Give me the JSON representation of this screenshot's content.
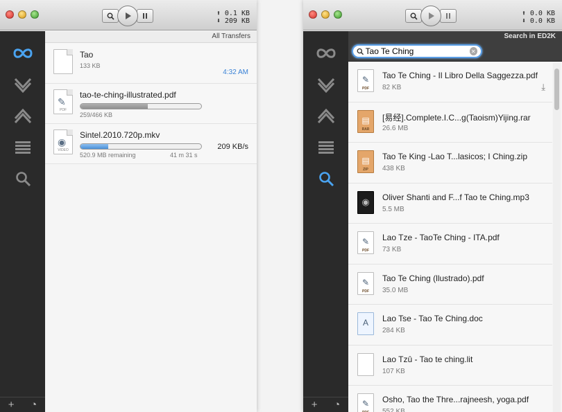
{
  "left_window": {
    "speeds": {
      "up": "0.1 KB",
      "down": "209 KB"
    },
    "header": "All Transfers",
    "transfers": [
      {
        "name": "Tao",
        "size": "133 KB",
        "time": "4:32 AM",
        "kind": ""
      },
      {
        "name": "tao-te-ching-illustrated.pdf",
        "size": "259/466 KB",
        "progress": 0.56,
        "kind": "PDF"
      },
      {
        "name": "Sintel.2010.720p.mkv",
        "remaining": "520.9 MB remaining",
        "eta": "41 m 31 s",
        "rate": "209 KB/s",
        "progress": 0.23,
        "kind": "VIDEO"
      }
    ]
  },
  "right_window": {
    "speeds": {
      "up": "0.0 KB",
      "down": "0.0 KB"
    },
    "header": "Search in ED2K",
    "search": {
      "value": "Tao Te Ching"
    },
    "results": [
      {
        "name": "Tao Te Ching - Il Libro Della Saggezza.pdf",
        "size": "82 KB",
        "type": "pdf",
        "kind": "PDF"
      },
      {
        "name": "[易经].Complete.I.C...g(Taoism)Yijing.rar",
        "size": "26.6 MB",
        "type": "rar",
        "kind": "RAR"
      },
      {
        "name": "Tao Te King -Lao T...lasicos; I Ching.zip",
        "size": "438 KB",
        "type": "zip",
        "kind": "ZIP"
      },
      {
        "name": "Oliver Shanti and F...f Tao te Ching.mp3",
        "size": "5.5 MB",
        "type": "mp3",
        "kind": ""
      },
      {
        "name": "Lao Tze - TaoTe Ching - ITA.pdf",
        "size": "73 KB",
        "type": "pdf",
        "kind": "PDF"
      },
      {
        "name": "Tao Te Ching (llustrado).pdf",
        "size": "35.0 MB",
        "type": "pdf",
        "kind": "PDF"
      },
      {
        "name": "Lao Tse - Tao Te Ching.doc",
        "size": "284 KB",
        "type": "doc",
        "kind": ""
      },
      {
        "name": "Lao Tzû - Tao te ching.lit",
        "size": "107 KB",
        "type": "lit",
        "kind": ""
      },
      {
        "name": "Osho, Tao the Thre...rajneesh, yoga.pdf",
        "size": "552 KB",
        "type": "pdf",
        "kind": "PDF"
      }
    ]
  },
  "colors": {
    "accent_blue": "#3a82d6",
    "sidebar": "#2a2a2a"
  }
}
